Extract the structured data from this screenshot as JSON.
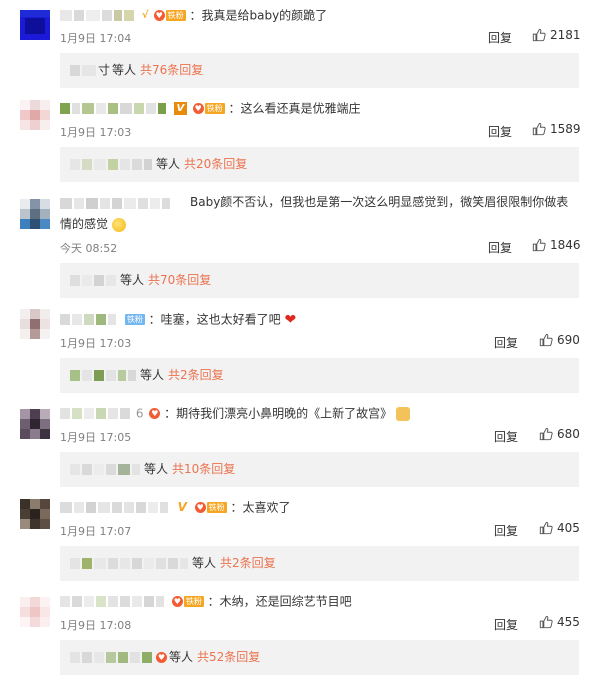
{
  "comments": [
    {
      "text": "：我真是给baby的颜跪了",
      "badge": "铁粉",
      "time": "1月9日 17:04",
      "reply": "回复",
      "likes": "2181",
      "sub_who": "等人",
      "sub_count": "共76条回复",
      "sub_prefix": "寸"
    },
    {
      "text": "：这么看还真是优雅端庄",
      "badge": "铁粉",
      "time": "1月9日 17:03",
      "reply": "回复",
      "likes": "1589",
      "sub_who": "等人",
      "sub_count": "共20条回复"
    },
    {
      "text_line1": "Baby颜不否认，但我也是第一次这么明显感觉到，微笑眉很限制你做表",
      "text_line2": "情的感觉",
      "time": "今天 08:52",
      "reply": "回复",
      "likes": "1846",
      "sub_who": "等人",
      "sub_count": "共70条回复"
    },
    {
      "text": "：哇塞，这也太好看了吧",
      "badge": "铁粉",
      "time": "1月9日 17:03",
      "reply": "回复",
      "likes": "690",
      "sub_who": "等人",
      "sub_count": "共2条回复"
    },
    {
      "name_suffix": "6",
      "text": "：期待我们漂亮小鼻明晚的《上新了故宫》",
      "time": "1月9日 17:05",
      "reply": "回复",
      "likes": "680",
      "sub_who": "等人",
      "sub_count": "共10条回复"
    },
    {
      "text": "：太喜欢了",
      "badge": "铁粉",
      "time": "1月9日 17:07",
      "reply": "回复",
      "likes": "405",
      "sub_who": "等人",
      "sub_count": "共2条回复"
    },
    {
      "text": "：木纳，还是回综艺节目吧",
      "badge": "铁粉",
      "time": "1月9日 17:08",
      "reply": "回复",
      "likes": "455",
      "sub_who": "等人",
      "sub_count": "共52条回复"
    }
  ]
}
